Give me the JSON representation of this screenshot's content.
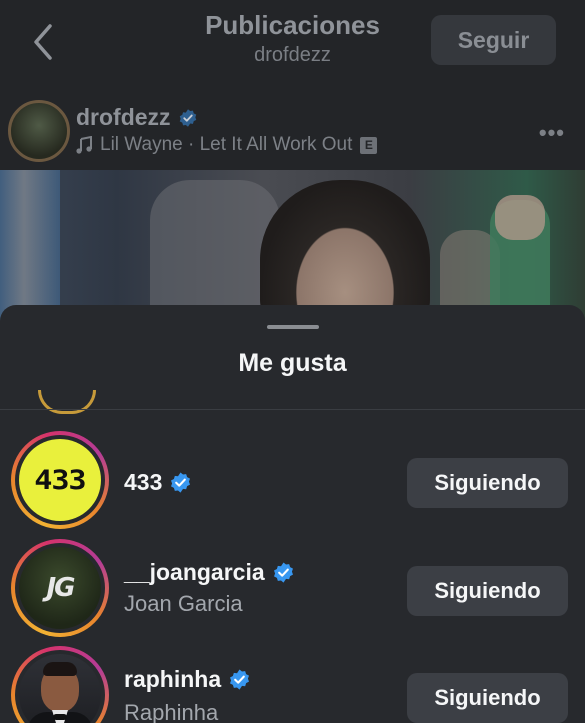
{
  "header": {
    "title": "Publicaciones",
    "subtitle": "drofdezz",
    "follow_label": "Seguir"
  },
  "post": {
    "username": "drofdezz",
    "music": "Lil Wayne · Let It All Work Out",
    "explicit_badge": "E"
  },
  "likes_sheet": {
    "title": "Me gusta",
    "users": [
      {
        "username": "433",
        "full_name": "",
        "avatar_text": "433",
        "verified": true,
        "button_label": "Siguiendo"
      },
      {
        "username": "__joangarcia",
        "full_name": "Joan Garcia",
        "avatar_text": "JG",
        "verified": true,
        "button_label": "Siguiendo"
      },
      {
        "username": "raphinha",
        "full_name": "Raphinha",
        "avatar_text": "",
        "verified": true,
        "button_label": "Siguiendo"
      }
    ]
  },
  "colors": {
    "verified_blue": "#3897f0",
    "story_ring": "#e8842d",
    "avatar_433_bg": "#e9f03c"
  },
  "icons": [
    "back-chevron-icon",
    "verified-badge-icon",
    "music-note-icon",
    "more-options-icon"
  ]
}
